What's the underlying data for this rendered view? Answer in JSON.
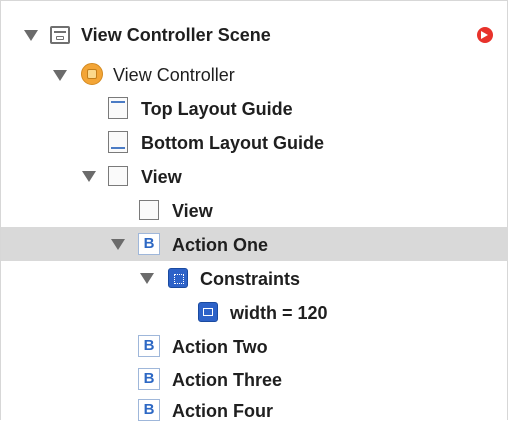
{
  "outline": {
    "rows": [
      {
        "label": "View Controller Scene",
        "icon": "scene-icon",
        "expanded": true,
        "badge": "warning-arrow-icon"
      },
      {
        "label": "View Controller",
        "icon": "view-controller-icon",
        "expanded": true
      },
      {
        "label": "Top Layout Guide",
        "icon": "top-layout-guide-icon"
      },
      {
        "label": "Bottom Layout Guide",
        "icon": "bottom-layout-guide-icon"
      },
      {
        "label": "View",
        "icon": "view-icon",
        "expanded": true
      },
      {
        "label": "View",
        "icon": "view-icon"
      },
      {
        "label": "Action One",
        "icon": "button-icon",
        "expanded": true,
        "selected": true,
        "glyph": "B"
      },
      {
        "label": "Constraints",
        "icon": "constraints-icon",
        "expanded": true
      },
      {
        "label": "width = 120",
        "icon": "width-constraint-icon"
      },
      {
        "label": "Action Two",
        "icon": "button-icon",
        "glyph": "B"
      },
      {
        "label": "Action Three",
        "icon": "button-icon",
        "glyph": "B"
      },
      {
        "label": "Action Four",
        "icon": "button-icon",
        "glyph": "B"
      }
    ]
  },
  "colors": {
    "selection": "#d9d9d9",
    "badge": "#e8322b",
    "view_controller_icon": "#f3a536",
    "constraint_icon": "#2d62c8"
  }
}
